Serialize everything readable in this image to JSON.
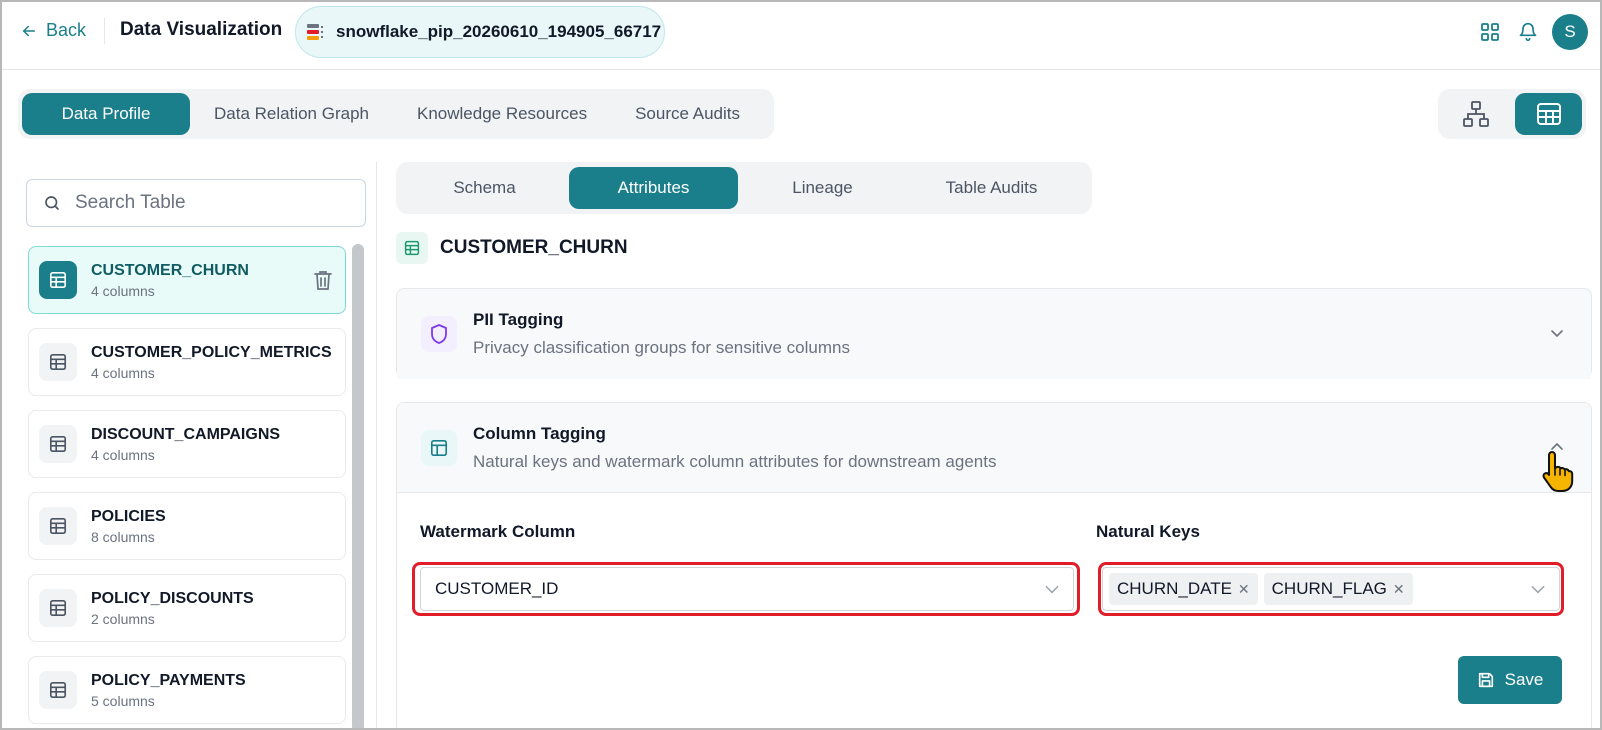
{
  "topbar": {
    "back_label": "Back",
    "app_title": "Data Visualization",
    "connection_name": "snowflake_pip_20260610_194905_66717",
    "avatar_initial": "S"
  },
  "main_tabs": [
    {
      "label": "Data Profile",
      "active": true
    },
    {
      "label": "Data Relation Graph",
      "active": false
    },
    {
      "label": "Knowledge Resources",
      "active": false
    },
    {
      "label": "Source Audits",
      "active": false
    }
  ],
  "view_toggle": {
    "options": [
      "hierarchy-icon",
      "table-grid-icon"
    ],
    "active": "table-grid-icon"
  },
  "search": {
    "placeholder": "Search Table",
    "value": ""
  },
  "tables": [
    {
      "name": "CUSTOMER_CHURN",
      "columns": "4 columns",
      "active": true
    },
    {
      "name": "CUSTOMER_POLICY_METRICS",
      "columns": "4 columns",
      "active": false
    },
    {
      "name": "DISCOUNT_CAMPAIGNS",
      "columns": "4 columns",
      "active": false
    },
    {
      "name": "POLICIES",
      "columns": "8 columns",
      "active": false
    },
    {
      "name": "POLICY_DISCOUNTS",
      "columns": "2 columns",
      "active": false
    },
    {
      "name": "POLICY_PAYMENTS",
      "columns": "5 columns",
      "active": false
    }
  ],
  "sub_tabs": [
    {
      "label": "Schema",
      "active": false
    },
    {
      "label": "Attributes",
      "active": true
    },
    {
      "label": "Lineage",
      "active": false
    },
    {
      "label": "Table Audits",
      "active": false
    }
  ],
  "selected_table": "CUSTOMER_CHURN",
  "pii_section": {
    "title": "PII Tagging",
    "subtitle": "Privacy classification groups for sensitive columns",
    "expanded": false
  },
  "column_section": {
    "title": "Column Tagging",
    "subtitle": "Natural keys and watermark column attributes for downstream agents",
    "expanded": true,
    "watermark_label": "Watermark Column",
    "watermark_value": "CUSTOMER_ID",
    "natural_keys_label": "Natural Keys",
    "natural_keys": [
      "CHURN_DATE",
      "CHURN_FLAG"
    ],
    "save_label": "Save"
  },
  "colors": {
    "accent": "#1a7f8a",
    "highlight": "#e11d2a",
    "pii_icon": "#7c3aed"
  }
}
